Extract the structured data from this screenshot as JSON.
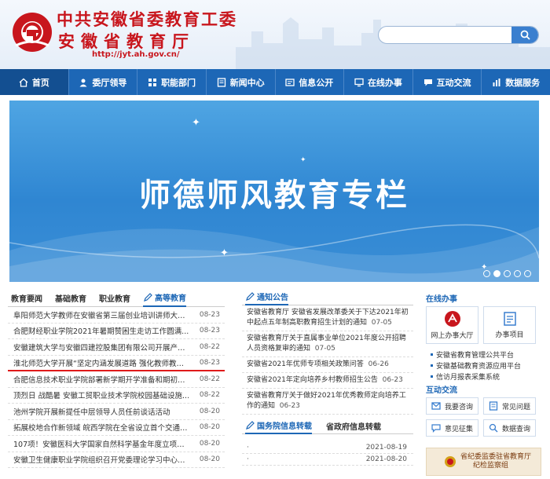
{
  "header": {
    "title_line1": "中共安徽省委教育工委",
    "title_line2": "安徽省教育厅",
    "url": "http://jyt.ah.gov.cn/",
    "search_placeholder": ""
  },
  "nav": {
    "items": [
      {
        "label": "首页",
        "icon": "home-icon"
      },
      {
        "label": "委厅领导",
        "icon": "leaders-icon"
      },
      {
        "label": "职能部门",
        "icon": "department-icon"
      },
      {
        "label": "新闻中心",
        "icon": "news-icon"
      },
      {
        "label": "信息公开",
        "icon": "info-icon"
      },
      {
        "label": "在线办事",
        "icon": "online-service-icon"
      },
      {
        "label": "互动交流",
        "icon": "chat-icon"
      },
      {
        "label": "数据服务",
        "icon": "data-icon"
      }
    ],
    "active_index": 0
  },
  "banner": {
    "title": "师德师风教育专栏",
    "slide_count": 5,
    "active_slide": 1
  },
  "news": {
    "tabs": [
      "教育要闻",
      "基础教育",
      "职业教育",
      "高等教育"
    ],
    "active_tab": 3,
    "items": [
      {
        "title": "阜阳师范大学教师在安徽省第三届创业培训讲师大赛...",
        "date": "08-23"
      },
      {
        "title": "合肥财经职业学院2021年暑期赞困生走访工作圆满...",
        "date": "08-23"
      },
      {
        "title": "安徽建筑大学与安徽四建控股集团有限公司开展产学...",
        "date": "08-22"
      },
      {
        "title": "淮北师范大学开展“坚定内涵发展道路 强化教师教育...",
        "date": "08-23"
      },
      {
        "title": "合肥信息技术职业学院部署新学期开学准备和期初工作",
        "date": "08-22"
      },
      {
        "title": "顶烈日 战酷暑 安徽工贸职业技术学院校园基础设施...",
        "date": "08-22"
      },
      {
        "title": "池州学院开展新提任中层领导人员任前谈话活动",
        "date": "08-20"
      },
      {
        "title": "拓展校地合作新领域 皖西学院在全省设立首个交通综...",
        "date": "08-20"
      },
      {
        "title": "107项！安徽医科大学国家自然科学基金年度立项再...",
        "date": "08-20"
      },
      {
        "title": "安徽卫生健康职业学院组织召开党委理论学习中心组...",
        "date": "08-20"
      }
    ],
    "highlight_index": 3
  },
  "notices": {
    "title": "通知公告",
    "items": [
      {
        "text": "安徽省教育厅 安徽省发展改革委关于下达2021年初中起点五年制高职教育招生计划的通知",
        "date": "07-05"
      },
      {
        "text": "安徽省教育厅关于直属事业单位2021年度公开招聘人员资格复审的通知",
        "date": "07-05"
      },
      {
        "text": "安徽省2021年优师专项相关政策问答",
        "date": "06-26"
      },
      {
        "text": "安徽省2021年定向培养乡村教师招生公告",
        "date": "06-23"
      },
      {
        "text": "安徽省教育厅关于做好2021年优秀教师定向培养工作的通知",
        "date": "06-23"
      }
    ]
  },
  "transfers": {
    "tabs": [
      "国务院信息转载",
      "省政府信息转载"
    ],
    "active_tab": 0,
    "items": [
      {
        "bullet": "·",
        "date": "2021-08-19"
      },
      {
        "bullet": "·",
        "date": "2021-08-20"
      }
    ]
  },
  "online": {
    "title": "在线办事",
    "big_buttons": [
      {
        "label": "网上办事大厅",
        "icon": "hall-icon"
      },
      {
        "label": "办事项目",
        "icon": "list-icon"
      }
    ],
    "links": [
      "安徽省教育管理公共平台",
      "安徽基础教育资源应用平台",
      "信访月报表采集系统"
    ]
  },
  "interact": {
    "title": "互动交流",
    "buttons": [
      {
        "label": "我要咨询",
        "icon": "consult-icon"
      },
      {
        "label": "常见问题",
        "icon": "faq-icon"
      },
      {
        "label": "意见征集",
        "icon": "feedback-icon"
      },
      {
        "label": "数据查询",
        "icon": "query-icon"
      }
    ]
  },
  "supervise": {
    "line1": "省纪委监委驻省教育厅",
    "line2": "纪检监察组"
  },
  "colors": {
    "brand_red": "#c8161d",
    "nav_blue": "#1d67b6",
    "highlight_red": "#e01a1a"
  }
}
